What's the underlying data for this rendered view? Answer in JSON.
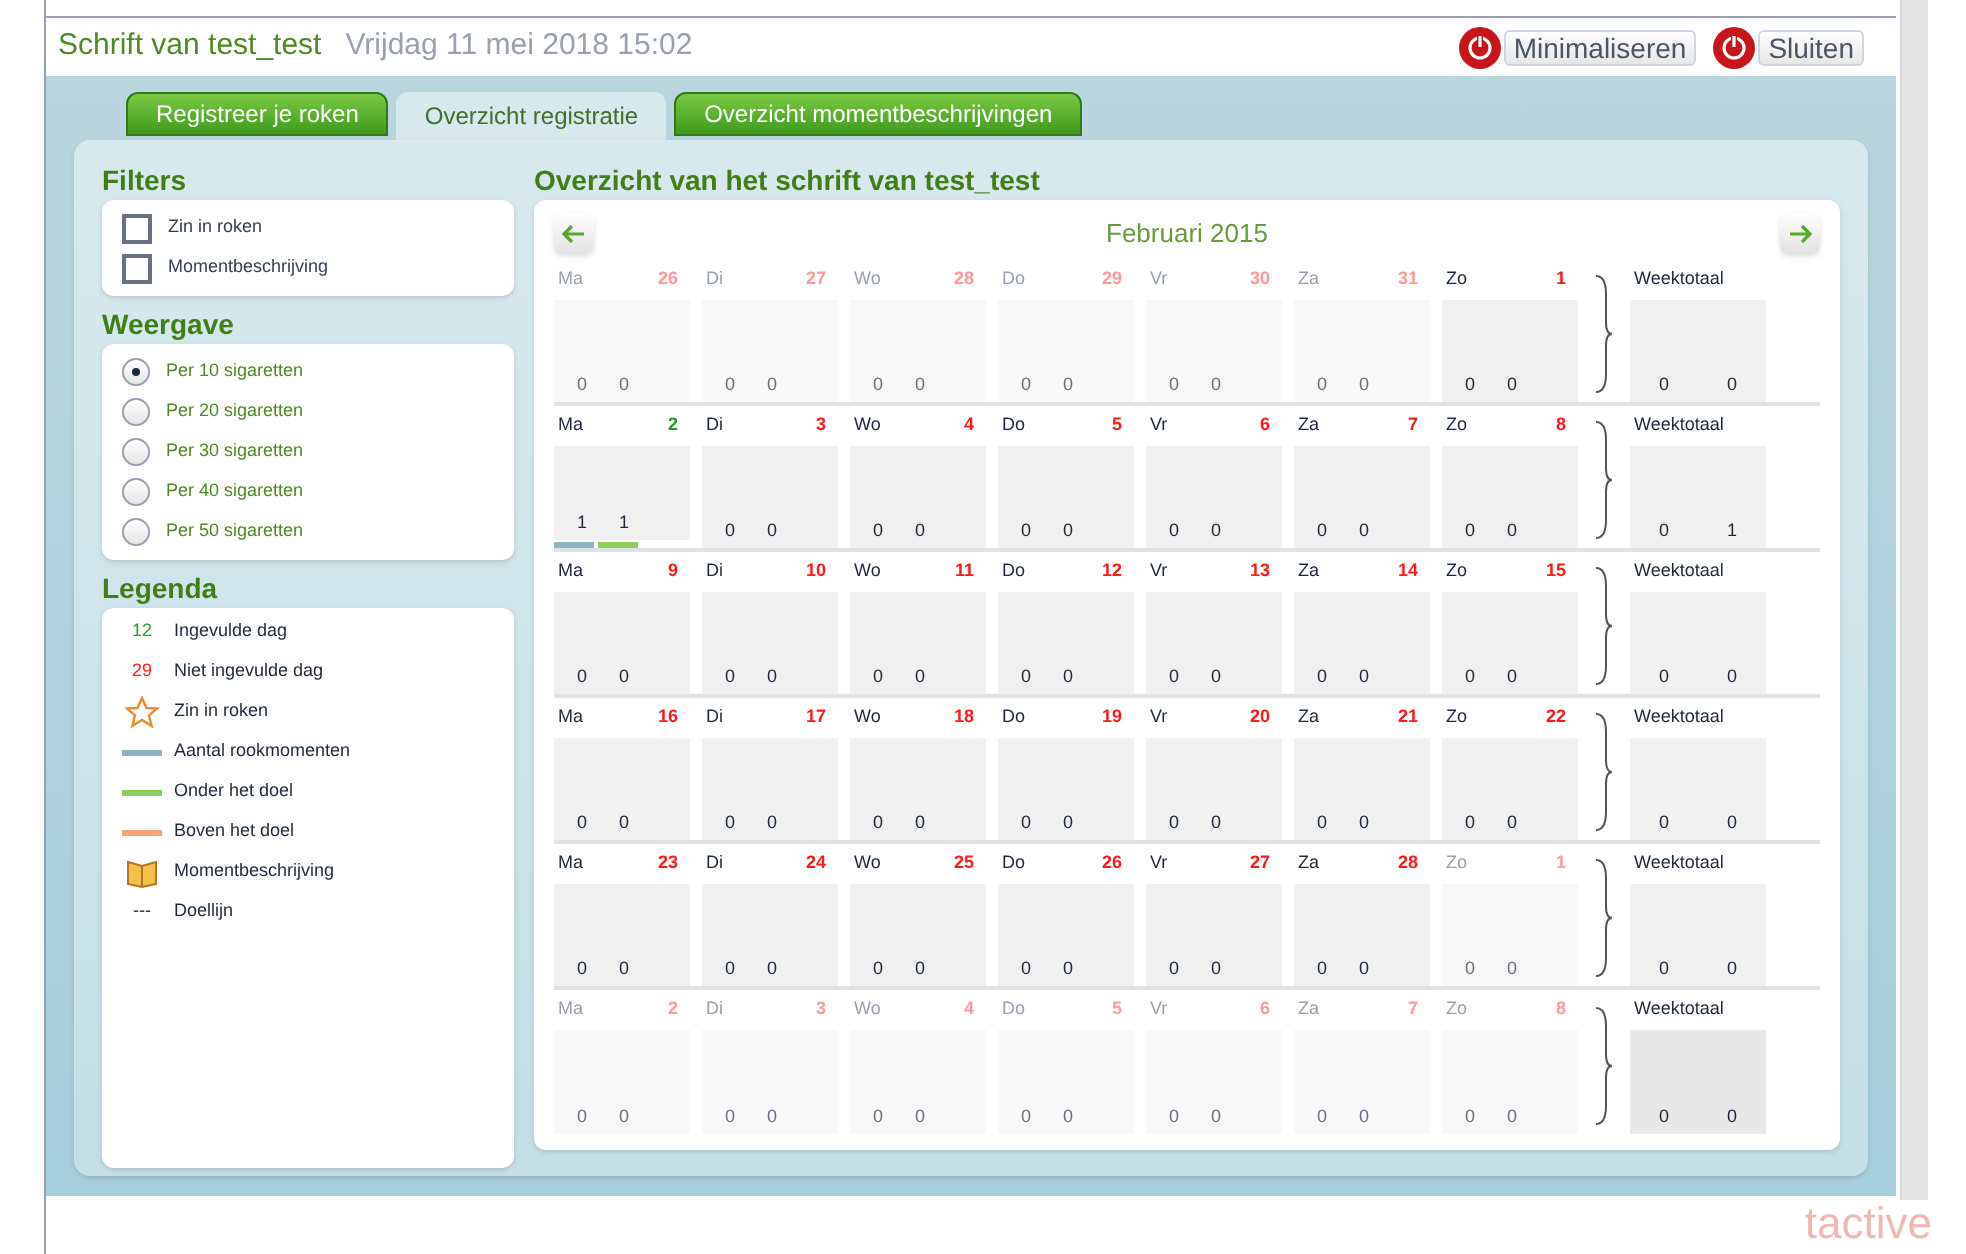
{
  "header": {
    "title": "Schrift van test_test",
    "datetime": "Vrijdag 11 mei 2018 15:02",
    "buttons": [
      "Minimaliseren",
      "Sluiten"
    ]
  },
  "tabs": [
    {
      "label": "Registreer je roken",
      "selected": false
    },
    {
      "label": "Overzicht registratie",
      "selected": true
    },
    {
      "label": "Overzicht momentbeschrijvingen",
      "selected": false
    }
  ],
  "filters": {
    "title": "Filters",
    "items": [
      {
        "label": "Zin in roken",
        "checked": false
      },
      {
        "label": "Momentbeschrijving",
        "checked": false
      }
    ]
  },
  "weergave": {
    "title": "Weergave",
    "options": [
      {
        "label": "Per 10 sigaretten",
        "selected": true
      },
      {
        "label": "Per 20 sigaretten",
        "selected": false
      },
      {
        "label": "Per 30 sigaretten",
        "selected": false
      },
      {
        "label": "Per 40 sigaretten",
        "selected": false
      },
      {
        "label": "Per 50 sigaretten",
        "selected": false
      }
    ]
  },
  "legend": {
    "title": "Legenda",
    "items": [
      {
        "kind": "number",
        "symbol": "12",
        "color": "#2e9a2e",
        "label": "Ingevulde dag"
      },
      {
        "kind": "number",
        "symbol": "29",
        "color": "#ff1a1a",
        "label": "Niet ingevulde dag"
      },
      {
        "kind": "star",
        "label": "Zin in roken"
      },
      {
        "kind": "line",
        "color": "#8fb3c2",
        "label": "Aantal rookmomenten"
      },
      {
        "kind": "line",
        "color": "#8ccf5a",
        "label": "Onder het doel"
      },
      {
        "kind": "line",
        "color": "#f7a572",
        "label": "Boven het doel"
      },
      {
        "kind": "book",
        "label": "Momentbeschrijving"
      },
      {
        "kind": "dash",
        "symbol": "---",
        "label": "Doellijn"
      }
    ]
  },
  "calendar": {
    "title": "Overzicht van het schrift van test_test",
    "month": "Februari 2015",
    "weeks": [
      {
        "days": [
          {
            "day": "Ma",
            "date": "26",
            "in_month": false,
            "filled": false,
            "values": [
              "0",
              "0"
            ]
          },
          {
            "day": "Di",
            "date": "27",
            "in_month": false,
            "filled": false,
            "values": [
              "0",
              "0"
            ]
          },
          {
            "day": "Wo",
            "date": "28",
            "in_month": false,
            "filled": false,
            "values": [
              "0",
              "0"
            ]
          },
          {
            "day": "Do",
            "date": "29",
            "in_month": false,
            "filled": false,
            "values": [
              "0",
              "0"
            ]
          },
          {
            "day": "Vr",
            "date": "30",
            "in_month": false,
            "filled": false,
            "values": [
              "0",
              "0"
            ]
          },
          {
            "day": "Za",
            "date": "31",
            "in_month": false,
            "filled": false,
            "values": [
              "0",
              "0"
            ]
          },
          {
            "day": "Zo",
            "date": "1",
            "in_month": true,
            "filled": false,
            "values": [
              "0",
              "0"
            ]
          }
        ],
        "total": {
          "label": "Weektotaal",
          "values": [
            "0",
            "0"
          ]
        }
      },
      {
        "days": [
          {
            "day": "Ma",
            "date": "2",
            "in_month": true,
            "filled": true,
            "values": [
              "1",
              "1"
            ],
            "bars": true
          },
          {
            "day": "Di",
            "date": "3",
            "in_month": true,
            "filled": false,
            "values": [
              "0",
              "0"
            ]
          },
          {
            "day": "Wo",
            "date": "4",
            "in_month": true,
            "filled": false,
            "values": [
              "0",
              "0"
            ]
          },
          {
            "day": "Do",
            "date": "5",
            "in_month": true,
            "filled": false,
            "values": [
              "0",
              "0"
            ]
          },
          {
            "day": "Vr",
            "date": "6",
            "in_month": true,
            "filled": false,
            "values": [
              "0",
              "0"
            ]
          },
          {
            "day": "Za",
            "date": "7",
            "in_month": true,
            "filled": false,
            "values": [
              "0",
              "0"
            ]
          },
          {
            "day": "Zo",
            "date": "8",
            "in_month": true,
            "filled": false,
            "values": [
              "0",
              "0"
            ]
          }
        ],
        "total": {
          "label": "Weektotaal",
          "values": [
            "0",
            "1"
          ]
        }
      },
      {
        "days": [
          {
            "day": "Ma",
            "date": "9",
            "in_month": true,
            "filled": false,
            "values": [
              "0",
              "0"
            ]
          },
          {
            "day": "Di",
            "date": "10",
            "in_month": true,
            "filled": false,
            "values": [
              "0",
              "0"
            ]
          },
          {
            "day": "Wo",
            "date": "11",
            "in_month": true,
            "filled": false,
            "values": [
              "0",
              "0"
            ]
          },
          {
            "day": "Do",
            "date": "12",
            "in_month": true,
            "filled": false,
            "values": [
              "0",
              "0"
            ]
          },
          {
            "day": "Vr",
            "date": "13",
            "in_month": true,
            "filled": false,
            "values": [
              "0",
              "0"
            ]
          },
          {
            "day": "Za",
            "date": "14",
            "in_month": true,
            "filled": false,
            "values": [
              "0",
              "0"
            ]
          },
          {
            "day": "Zo",
            "date": "15",
            "in_month": true,
            "filled": false,
            "values": [
              "0",
              "0"
            ]
          }
        ],
        "total": {
          "label": "Weektotaal",
          "values": [
            "0",
            "0"
          ]
        }
      },
      {
        "days": [
          {
            "day": "Ma",
            "date": "16",
            "in_month": true,
            "filled": false,
            "values": [
              "0",
              "0"
            ]
          },
          {
            "day": "Di",
            "date": "17",
            "in_month": true,
            "filled": false,
            "values": [
              "0",
              "0"
            ]
          },
          {
            "day": "Wo",
            "date": "18",
            "in_month": true,
            "filled": false,
            "values": [
              "0",
              "0"
            ]
          },
          {
            "day": "Do",
            "date": "19",
            "in_month": true,
            "filled": false,
            "values": [
              "0",
              "0"
            ]
          },
          {
            "day": "Vr",
            "date": "20",
            "in_month": true,
            "filled": false,
            "values": [
              "0",
              "0"
            ]
          },
          {
            "day": "Za",
            "date": "21",
            "in_month": true,
            "filled": false,
            "values": [
              "0",
              "0"
            ]
          },
          {
            "day": "Zo",
            "date": "22",
            "in_month": true,
            "filled": false,
            "values": [
              "0",
              "0"
            ]
          }
        ],
        "total": {
          "label": "Weektotaal",
          "values": [
            "0",
            "0"
          ]
        }
      },
      {
        "days": [
          {
            "day": "Ma",
            "date": "23",
            "in_month": true,
            "filled": false,
            "values": [
              "0",
              "0"
            ]
          },
          {
            "day": "Di",
            "date": "24",
            "in_month": true,
            "filled": false,
            "values": [
              "0",
              "0"
            ]
          },
          {
            "day": "Wo",
            "date": "25",
            "in_month": true,
            "filled": false,
            "values": [
              "0",
              "0"
            ]
          },
          {
            "day": "Do",
            "date": "26",
            "in_month": true,
            "filled": false,
            "values": [
              "0",
              "0"
            ]
          },
          {
            "day": "Vr",
            "date": "27",
            "in_month": true,
            "filled": false,
            "values": [
              "0",
              "0"
            ]
          },
          {
            "day": "Za",
            "date": "28",
            "in_month": true,
            "filled": false,
            "values": [
              "0",
              "0"
            ]
          },
          {
            "day": "Zo",
            "date": "1",
            "in_month": false,
            "filled": false,
            "values": [
              "0",
              "0"
            ]
          }
        ],
        "total": {
          "label": "Weektotaal",
          "values": [
            "0",
            "0"
          ]
        }
      },
      {
        "days": [
          {
            "day": "Ma",
            "date": "2",
            "in_month": false,
            "filled": false,
            "values": [
              "0",
              "0"
            ]
          },
          {
            "day": "Di",
            "date": "3",
            "in_month": false,
            "filled": false,
            "values": [
              "0",
              "0"
            ]
          },
          {
            "day": "Wo",
            "date": "4",
            "in_month": false,
            "filled": false,
            "values": [
              "0",
              "0"
            ]
          },
          {
            "day": "Do",
            "date": "5",
            "in_month": false,
            "filled": false,
            "values": [
              "0",
              "0"
            ]
          },
          {
            "day": "Vr",
            "date": "6",
            "in_month": false,
            "filled": false,
            "values": [
              "0",
              "0"
            ]
          },
          {
            "day": "Za",
            "date": "7",
            "in_month": false,
            "filled": false,
            "values": [
              "0",
              "0"
            ]
          },
          {
            "day": "Zo",
            "date": "8",
            "in_month": false,
            "filled": false,
            "values": [
              "0",
              "0"
            ]
          }
        ],
        "total": {
          "label": "Weektotaal",
          "values": [
            "0",
            "0"
          ]
        }
      }
    ]
  },
  "footer_logo": "tactive"
}
